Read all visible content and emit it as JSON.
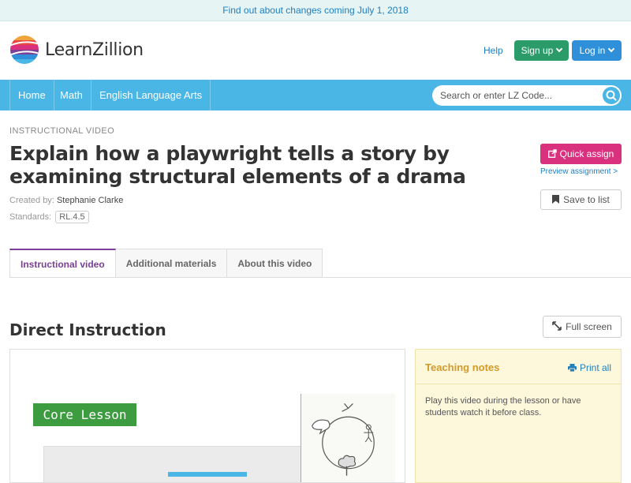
{
  "announcement": "Find out about changes coming July 1, 2018",
  "header": {
    "logo_text": "LearnZillion",
    "help": "Help",
    "signup": "Sign up",
    "login": "Log in"
  },
  "nav": {
    "items": [
      "Home",
      "Math",
      "English Language Arts"
    ],
    "search_placeholder": "Search or enter LZ Code..."
  },
  "lesson": {
    "eyebrow": "INSTRUCTIONAL VIDEO",
    "title": "Explain how a playwright tells a story by examining structural elements of a drama",
    "created_by_label": "Created by:",
    "author": "Stephanie Clarke",
    "standards_label": "Standards:",
    "standard": "RL.4.5"
  },
  "actions": {
    "quick_assign": "Quick assign",
    "preview": "Preview assignment >",
    "save_to_list": "Save to list"
  },
  "tabs": [
    "Instructional video",
    "Additional materials",
    "About this video"
  ],
  "section": {
    "heading": "Direct Instruction",
    "fullscreen": "Full screen"
  },
  "video": {
    "badge": "Core Lesson"
  },
  "notes": {
    "title": "Teaching notes",
    "print": "Print all",
    "body": "Play this video during the lesson or have students watch it before class."
  },
  "colors": {
    "nav": "#4ab6e6",
    "signup": "#2c9b6a",
    "login": "#2f8fd8",
    "quick_assign": "#d9317e",
    "active_tab": "#7b3f98",
    "core_badge": "#3d9b40",
    "notes_bg": "#fdf8dc"
  }
}
